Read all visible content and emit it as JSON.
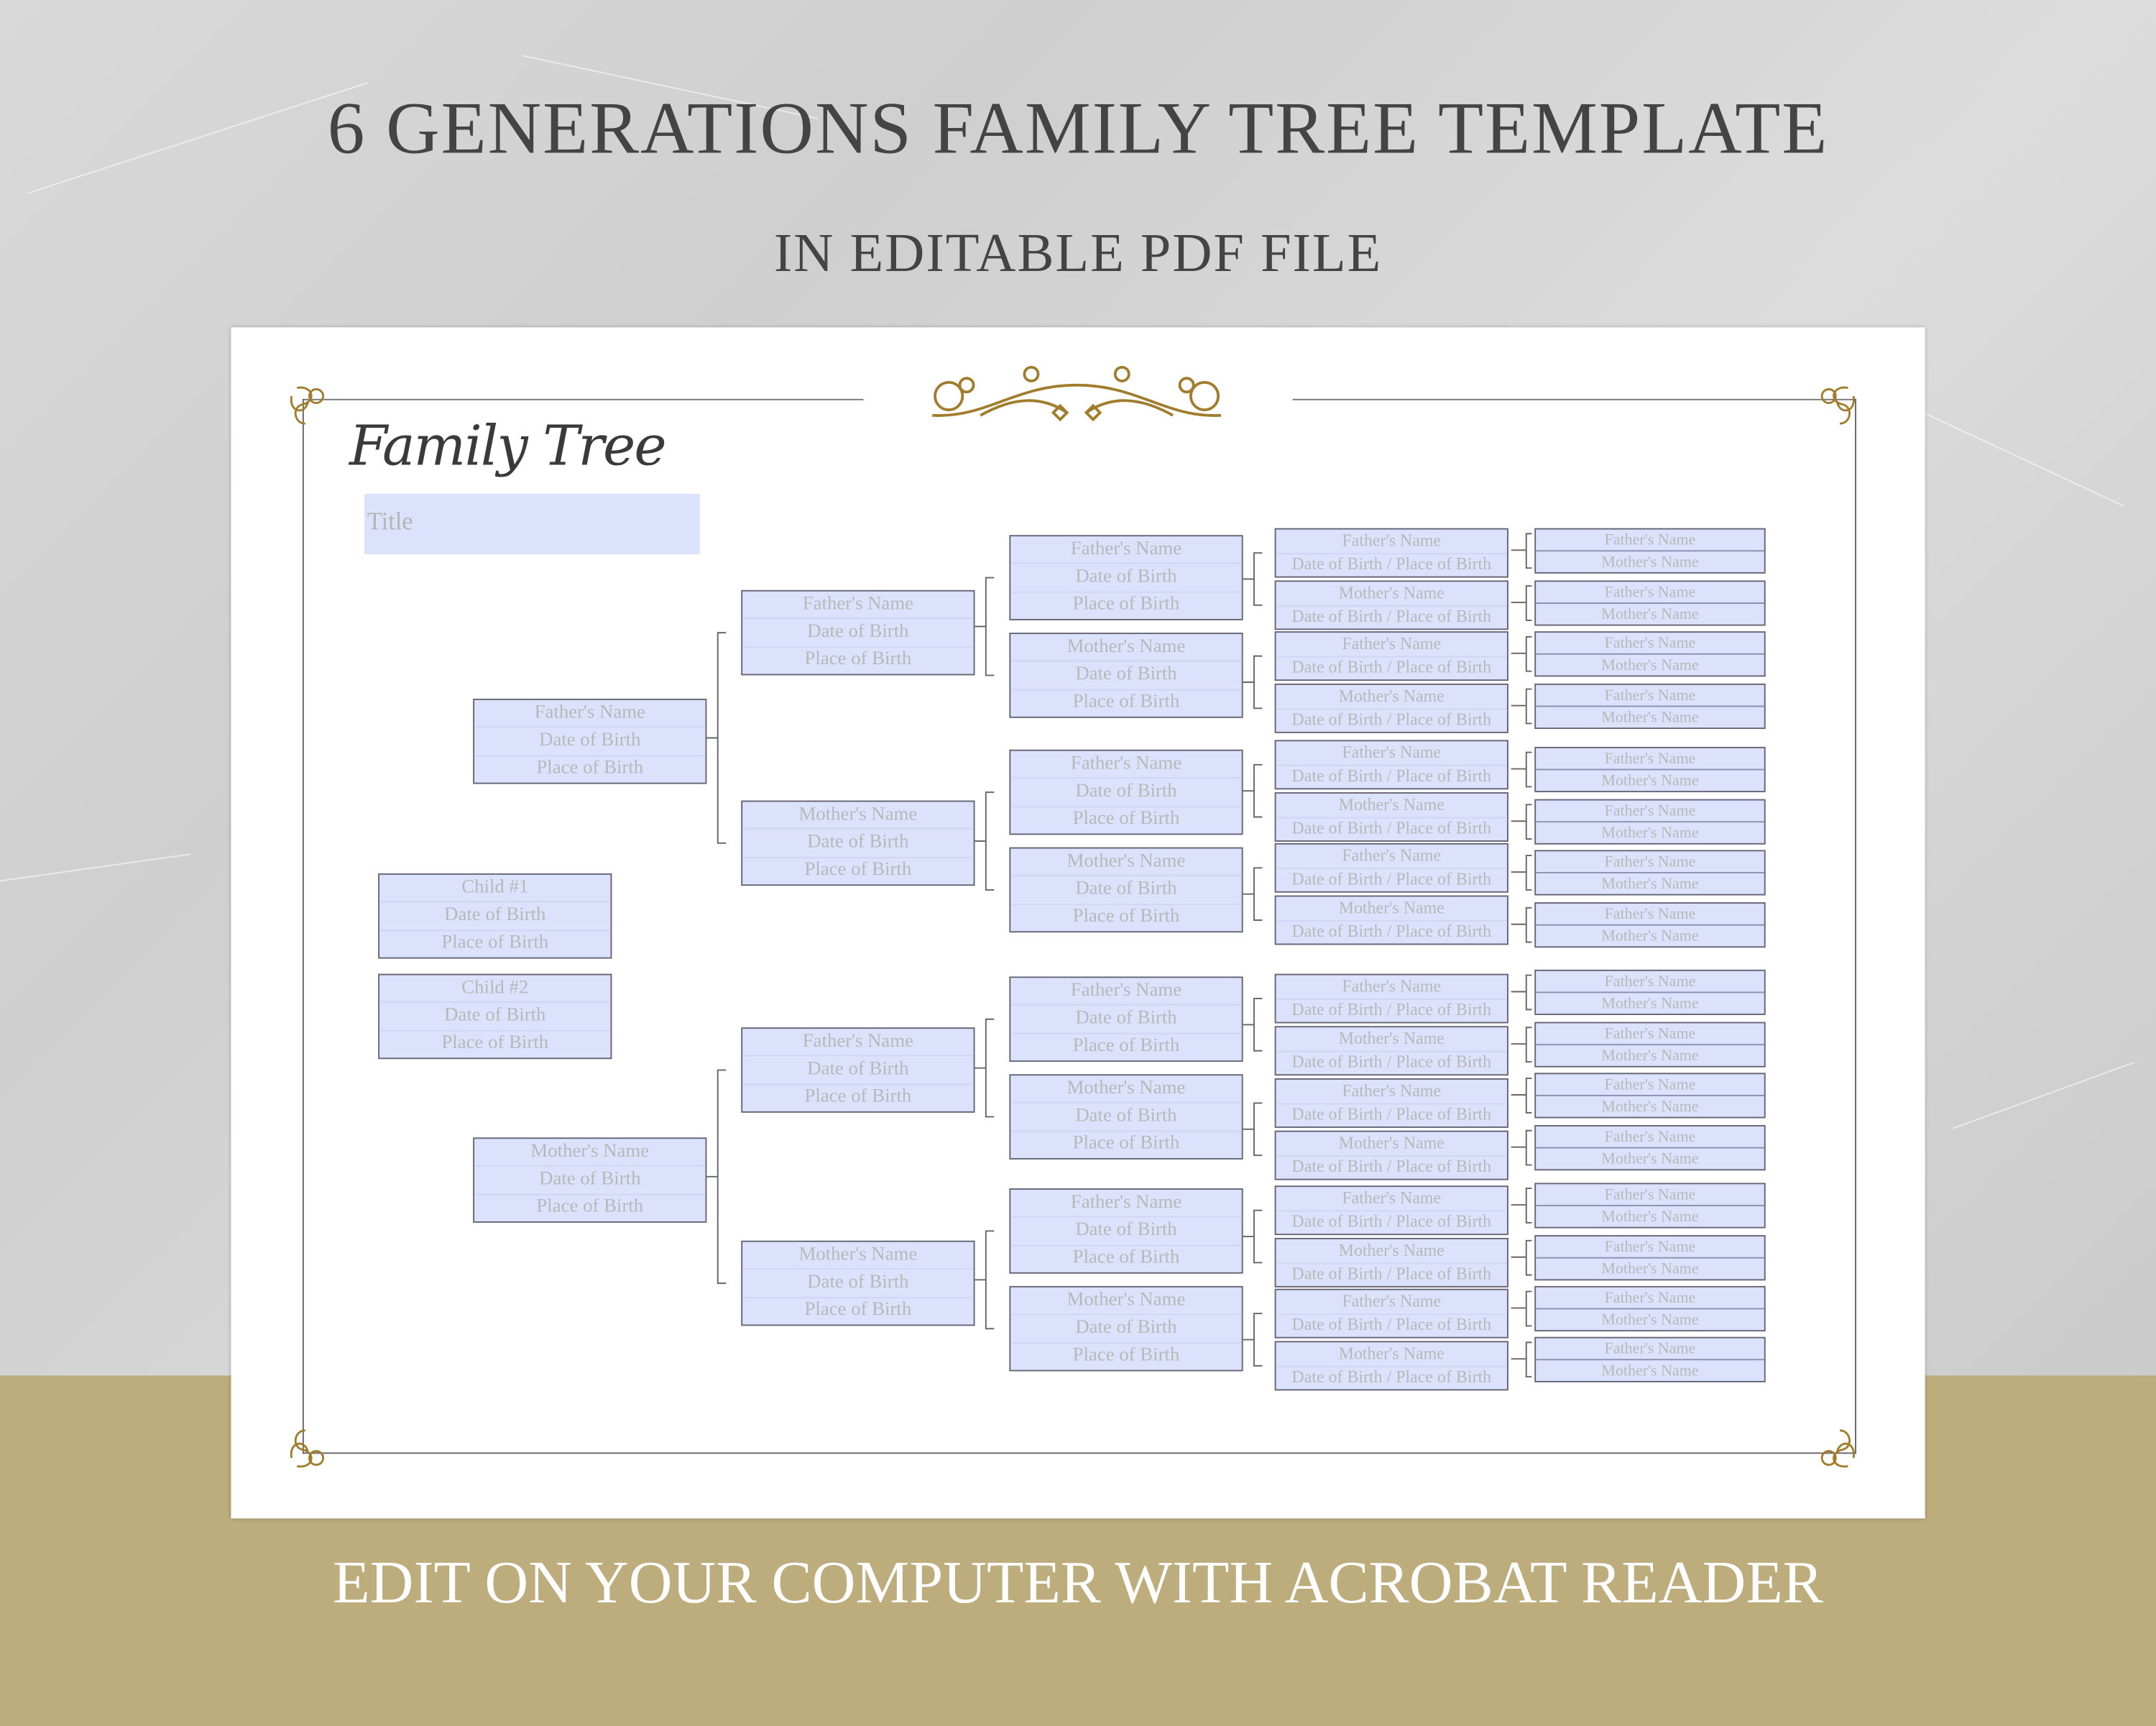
{
  "headline": {
    "line1": "6 GENERATIONS FAMILY TREE TEMPLATE",
    "line2": "IN EDITABLE PDF FILE"
  },
  "footer": "EDIT ON YOUR COMPUTER WITH ACROBAT READER",
  "colors": {
    "field_fill": "#dce2fc",
    "gold": "#a07c2c",
    "band": "#bdad7d",
    "headline_text": "#444444"
  },
  "sheet": {
    "heading": "Family Tree",
    "title_placeholder": "Title",
    "children": [
      {
        "name": "Child #1",
        "date": "Date of Birth",
        "place": "Place of Birth"
      },
      {
        "name": "Child #2",
        "date": "Date of Birth",
        "place": "Place of Birth"
      }
    ],
    "parents": [
      {
        "name": "Father's Name",
        "date": "Date of Birth",
        "place": "Place of Birth"
      },
      {
        "name": "Mother's Name",
        "date": "Date of Birth",
        "place": "Place of Birth"
      }
    ],
    "grandparents": [
      {
        "name": "Father's Name",
        "date": "Date of Birth",
        "place": "Place of Birth"
      },
      {
        "name": "Mother's Name",
        "date": "Date of Birth",
        "place": "Place of Birth"
      },
      {
        "name": "Father's Name",
        "date": "Date of Birth",
        "place": "Place of Birth"
      },
      {
        "name": "Mother's Name",
        "date": "Date of Birth",
        "place": "Place of Birth"
      }
    ],
    "great_grandparents": [
      {
        "name": "Father's Name",
        "date": "Date of Birth",
        "place": "Place of Birth"
      },
      {
        "name": "Mother's Name",
        "date": "Date of Birth",
        "place": "Place of Birth"
      },
      {
        "name": "Father's Name",
        "date": "Date of Birth",
        "place": "Place of Birth"
      },
      {
        "name": "Mother's Name",
        "date": "Date of Birth",
        "place": "Place of Birth"
      },
      {
        "name": "Father's Name",
        "date": "Date of Birth",
        "place": "Place of Birth"
      },
      {
        "name": "Mother's Name",
        "date": "Date of Birth",
        "place": "Place of Birth"
      },
      {
        "name": "Father's Name",
        "date": "Date of Birth",
        "place": "Place of Birth"
      },
      {
        "name": "Mother's Name",
        "date": "Date of Birth",
        "place": "Place of Birth"
      }
    ],
    "gen5_father_label": "Father's Name",
    "gen5_mother_label": "Mother's Name",
    "gen5_detail_label": "Date of Birth / Place of Birth",
    "gen6_father_label": "Father's Name",
    "gen6_mother_label": "Mother's Name",
    "gen5_count": 16,
    "gen6_count": 16
  }
}
